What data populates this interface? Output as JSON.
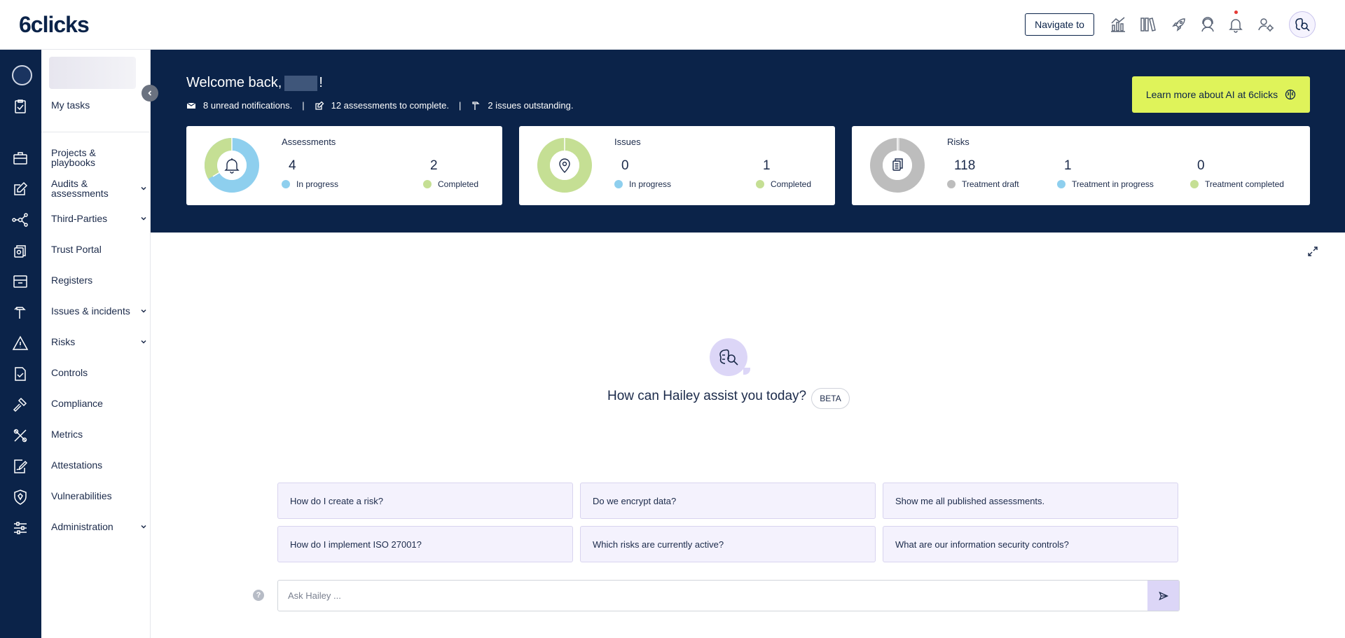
{
  "header": {
    "logo": "6clicks",
    "navigate_label": "Navigate to",
    "icons": [
      "analytics-icon",
      "library-icon",
      "rocket-icon",
      "support-icon",
      "bell-icon",
      "user-settings-icon",
      "hailey-ai-icon"
    ]
  },
  "sidebar": {
    "items": [
      {
        "label": "My tasks",
        "icon": "clipboard-check-icon"
      },
      {
        "label": "Projects & playbooks",
        "icon": "briefcase-icon"
      },
      {
        "label": "Audits & assessments",
        "icon": "edit-icon",
        "expandable": true
      },
      {
        "label": "Third-Parties",
        "icon": "network-icon",
        "expandable": true
      },
      {
        "label": "Trust Portal",
        "icon": "trust-icon"
      },
      {
        "label": "Registers",
        "icon": "archive-icon"
      },
      {
        "label": "Issues & incidents",
        "icon": "hammer-icon",
        "expandable": true
      },
      {
        "label": "Risks",
        "icon": "warning-icon",
        "expandable": true
      },
      {
        "label": "Controls",
        "icon": "file-check-icon"
      },
      {
        "label": "Compliance",
        "icon": "gavel-icon"
      },
      {
        "label": "Metrics",
        "icon": "tools-icon"
      },
      {
        "label": "Attestations",
        "icon": "signature-icon"
      },
      {
        "label": "Vulnerabilities",
        "icon": "shield-icon"
      },
      {
        "label": "Administration",
        "icon": "sliders-icon",
        "expandable": true
      }
    ]
  },
  "banner": {
    "welcome_prefix": "Welcome back,",
    "welcome_suffix": "!",
    "notifications": "8 unread notifications.",
    "assessments_pending": "12 assessments to complete.",
    "issues_outstanding": "2 issues outstanding.",
    "ai_button": "Learn more about AI at 6clicks"
  },
  "cards": {
    "assessments": {
      "title": "Assessments",
      "metrics": [
        {
          "value": "4",
          "label": "In progress",
          "color": "#8ecfee"
        },
        {
          "value": "2",
          "label": "Completed",
          "color": "#c5df94"
        }
      ]
    },
    "issues": {
      "title": "Issues",
      "metrics": [
        {
          "value": "0",
          "label": "In progress",
          "color": "#8ecfee"
        },
        {
          "value": "1",
          "label": "Completed",
          "color": "#c5df94"
        }
      ]
    },
    "risks": {
      "title": "Risks",
      "metrics": [
        {
          "value": "118",
          "label": "Treatment draft",
          "color": "#bdbdbd"
        },
        {
          "value": "1",
          "label": "Treatment in progress",
          "color": "#8ecfee"
        },
        {
          "value": "0",
          "label": "Treatment completed",
          "color": "#c5df94"
        }
      ]
    }
  },
  "assistant": {
    "prompt": "How can Hailey assist you today?",
    "badge": "BETA",
    "suggestions": [
      "How do I create a risk?",
      "Do we encrypt data?",
      "Show me all published assessments.",
      "How do I implement ISO 27001?",
      "Which risks are currently active?",
      "What are our information security controls?"
    ],
    "input_placeholder": "Ask Hailey ...",
    "help": "?"
  },
  "colors": {
    "navy": "#0b2349",
    "lime": "#dff35a",
    "lavender": "#dcd6f7",
    "blue": "#8ecfee",
    "green": "#c5df94",
    "grey": "#bdbdbd"
  }
}
